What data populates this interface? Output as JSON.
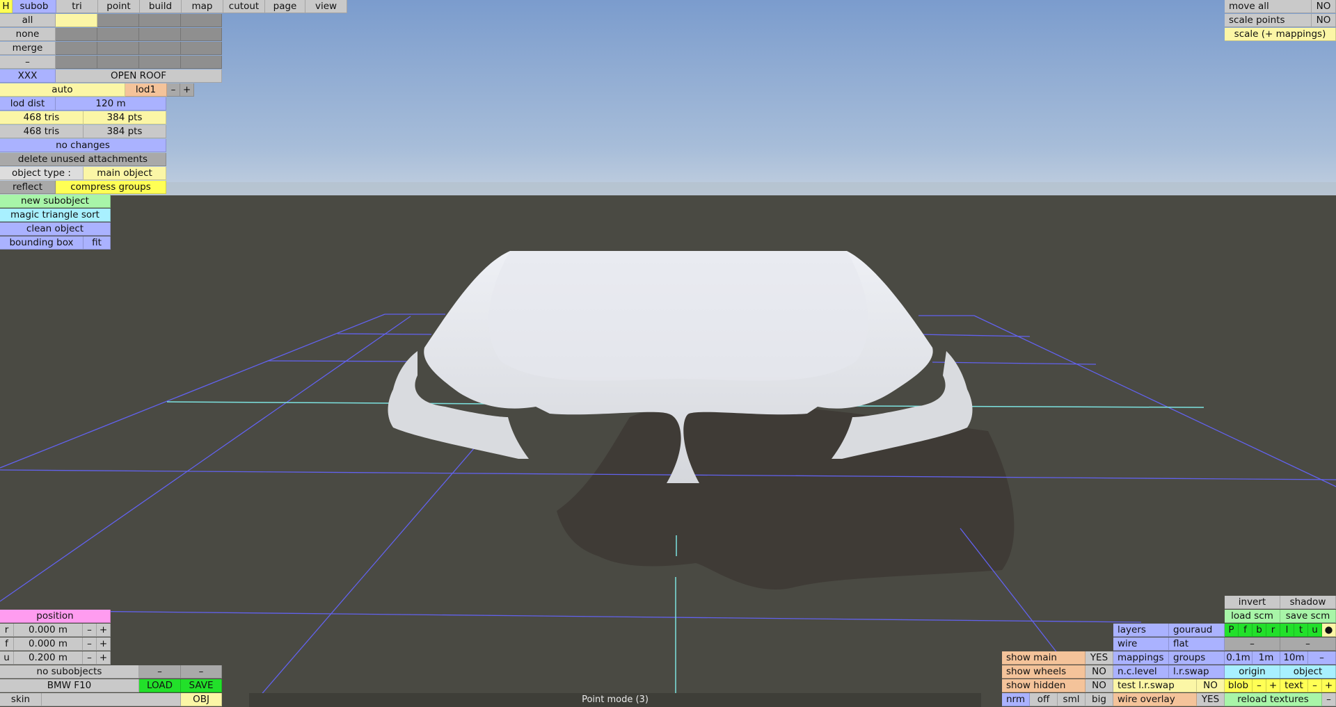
{
  "top_tabs": [
    "H",
    "subob",
    "tri",
    "point",
    "build",
    "map",
    "cutout",
    "page",
    "view"
  ],
  "select": {
    "all": "all",
    "none": "none",
    "merge": "merge",
    "minus": "–"
  },
  "subobject_name": "XXX",
  "roof_label": "OPEN ROOF",
  "lod": {
    "auto": "auto",
    "name": "lod1",
    "minus": "–",
    "plus": "+",
    "dist_label": "lod dist",
    "dist_value": "120 m"
  },
  "stats": [
    {
      "tris": "468 tris",
      "pts": "384 pts"
    },
    {
      "tris": "468 tris",
      "pts": "384 pts"
    }
  ],
  "changes": "no changes",
  "delete_unused": "delete unused attachments",
  "object_type_label": "object type :",
  "object_type_value": "main object",
  "reflect": "reflect",
  "compress_groups": "compress groups",
  "new_subobject": "new subobject",
  "magic_sort": "magic triangle sort",
  "clean_object": "clean object",
  "bounding_box": "bounding box",
  "fit": "fit",
  "position": {
    "title": "position",
    "rows": [
      {
        "axis": "r",
        "value": "0.000 m"
      },
      {
        "axis": "f",
        "value": "0.000 m"
      },
      {
        "axis": "u",
        "value": "0.200 m"
      }
    ],
    "minus": "–",
    "plus": "+"
  },
  "no_subobjects": "no subobjects",
  "dash": "–",
  "model_name": "BMW F10",
  "load": "LOAD",
  "save": "SAVE",
  "skin": "skin",
  "obj": "OBJ",
  "top_right": [
    {
      "label": "move all",
      "value": "NO"
    },
    {
      "label": "scale points",
      "value": "NO"
    }
  ],
  "scale_mappings": "scale (+ mappings)",
  "bottom_right": {
    "invert": "invert",
    "shadow": "shadow",
    "load_scm": "load scm",
    "save_scm": "save scm",
    "layers": "layers",
    "gouraud": "gouraud",
    "layer_letters": [
      "P",
      "f",
      "b",
      "r",
      "l",
      "t",
      "u",
      "●"
    ],
    "wire": "wire",
    "flat": "flat",
    "mappings": "mappings",
    "groups": "groups",
    "scale_steps": [
      "0.1m",
      "1m",
      "10m",
      "–"
    ],
    "nc_level": "n.c.level",
    "lr_swap": "l.r.swap",
    "origin": "origin",
    "object": "object",
    "blob": "blob",
    "text": "text",
    "reload": "reload textures",
    "show_main": "show main",
    "show_main_val": "YES",
    "show_wheels": "show wheels",
    "show_wheels_val": "NO",
    "show_hidden": "show hidden",
    "show_hidden_val": "NO",
    "test_swap": "test l.r.swap",
    "test_swap_val": "NO",
    "wire_overlay": "wire overlay",
    "wire_overlay_val": "YES",
    "view_modes": [
      "nrm",
      "off",
      "sml",
      "big"
    ]
  },
  "status": "Point mode (3)"
}
